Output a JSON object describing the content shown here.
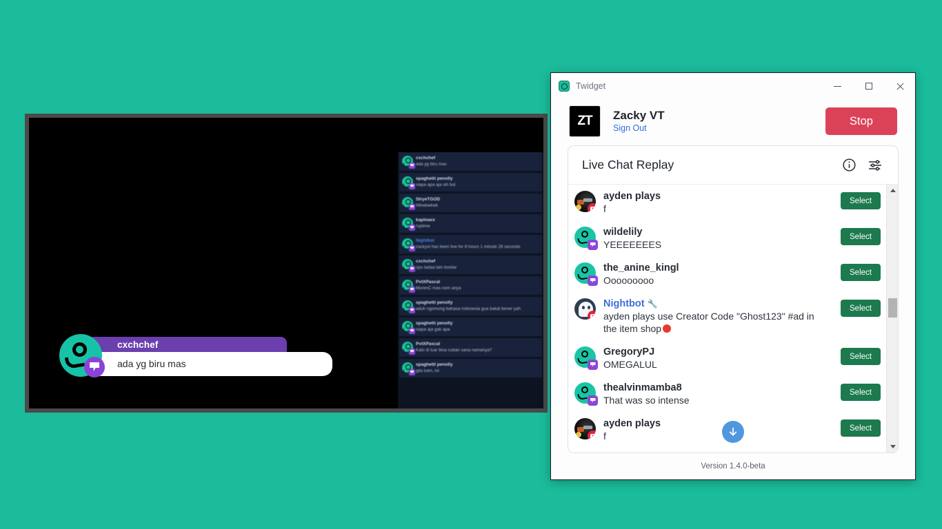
{
  "desktop": {
    "background_color": "#1bbc9b"
  },
  "stream_preview": {
    "name": "stream-preview",
    "overlay_widget": {
      "username": "cxchchef",
      "message": "ada yg biru mas",
      "name_bar_color": "#6b3fae",
      "avatar_color": "#17c3a6",
      "platform_badge": "twitch-icon"
    },
    "chat_sidebar": [
      {
        "user": "cxchchef",
        "message": "ada yg biru mas",
        "platform": "twitch",
        "is_bot": false
      },
      {
        "user": "spaghetti penolly",
        "message": "siapa apa aja sih bol",
        "platform": "twitch",
        "is_bot": false
      },
      {
        "user": "StryeTGOD",
        "message": "Wkwkwkwk",
        "platform": "twitch",
        "is_bot": false
      },
      {
        "user": "kapinaxx",
        "message": "!uptime",
        "platform": "twitch",
        "is_bot": false
      },
      {
        "user": "Nightbot",
        "message": "zackyvt has been live for 8 hours 1 minute 28 seconds",
        "platform": "twitch",
        "is_bot": true
      },
      {
        "user": "cxchchef",
        "message": "cpu tadaa lain bordar",
        "platform": "twitch",
        "is_bot": false
      },
      {
        "user": "PvtXPascal",
        "message": "MurenC mas nom anya",
        "platform": "twitch",
        "is_bot": false
      },
      {
        "user": "spaghetti penolly",
        "message": "aduh ngomong bahasa indonesia gua bakal bener yah",
        "platform": "twitch",
        "is_bot": false
      },
      {
        "user": "spaghetti penolly",
        "message": "siapa aja gak apa",
        "platform": "twitch",
        "is_bot": false
      },
      {
        "user": "PvtXPascal",
        "message": "Kalo di luar bisa cuban sana namanya?",
        "platform": "twitch",
        "is_bot": false
      },
      {
        "user": "spaghetti penolly",
        "message": "gila tuen, lol",
        "platform": "twitch",
        "is_bot": false
      }
    ]
  },
  "twidget": {
    "titlebar": {
      "app_icon": "twidget-logo-icon",
      "title": "Twidget",
      "minimize": "minimize-icon",
      "maximize": "maximize-icon",
      "close": "close-icon"
    },
    "profile": {
      "avatar_initials": "ZT",
      "display_name": "Zacky VT",
      "sign_out_label": "Sign Out",
      "action_button_label": "Stop",
      "action_button_color": "#dc4257"
    },
    "chat_panel": {
      "title": "Live Chat Replay",
      "info_icon": "info-circle-icon",
      "settings_icon": "sliders-icon",
      "select_button_label": "Select",
      "select_button_color": "#1c7a4e",
      "scroll_to_bottom_icon": "arrow-down-icon",
      "messages": [
        {
          "user": "ayden plays",
          "message": "f",
          "platform": "youtube",
          "avatar_type": "photo",
          "is_bot": false,
          "select_label": "Select"
        },
        {
          "user": "wildelily",
          "message": "YEEEEEEES",
          "platform": "twitch",
          "avatar_type": "generic",
          "is_bot": false,
          "select_label": "Select"
        },
        {
          "user": "the_anine_kingl",
          "message": "Ooooooooo",
          "platform": "twitch",
          "avatar_type": "generic",
          "is_bot": false,
          "select_label": "Select"
        },
        {
          "user": "Nightbot",
          "message": "ayden plays use Creator Code \"Ghost123\" #ad in the item shop",
          "platform": "youtube",
          "avatar_type": "ghost",
          "is_bot": true,
          "has_red_dot": true,
          "select_label": "Select"
        },
        {
          "user": "GregoryPJ",
          "message": "OMEGALUL",
          "platform": "twitch",
          "avatar_type": "generic",
          "is_bot": false,
          "select_label": "Select"
        },
        {
          "user": "thealvinmamba8",
          "message": "That was so intense",
          "platform": "twitch",
          "avatar_type": "generic",
          "is_bot": false,
          "select_label": "Select"
        },
        {
          "user": "ayden plays",
          "message": "f",
          "platform": "youtube",
          "avatar_type": "photo",
          "is_bot": false,
          "select_label": "Select"
        }
      ]
    },
    "footer": {
      "version": "Version 1.4.0-beta"
    }
  }
}
